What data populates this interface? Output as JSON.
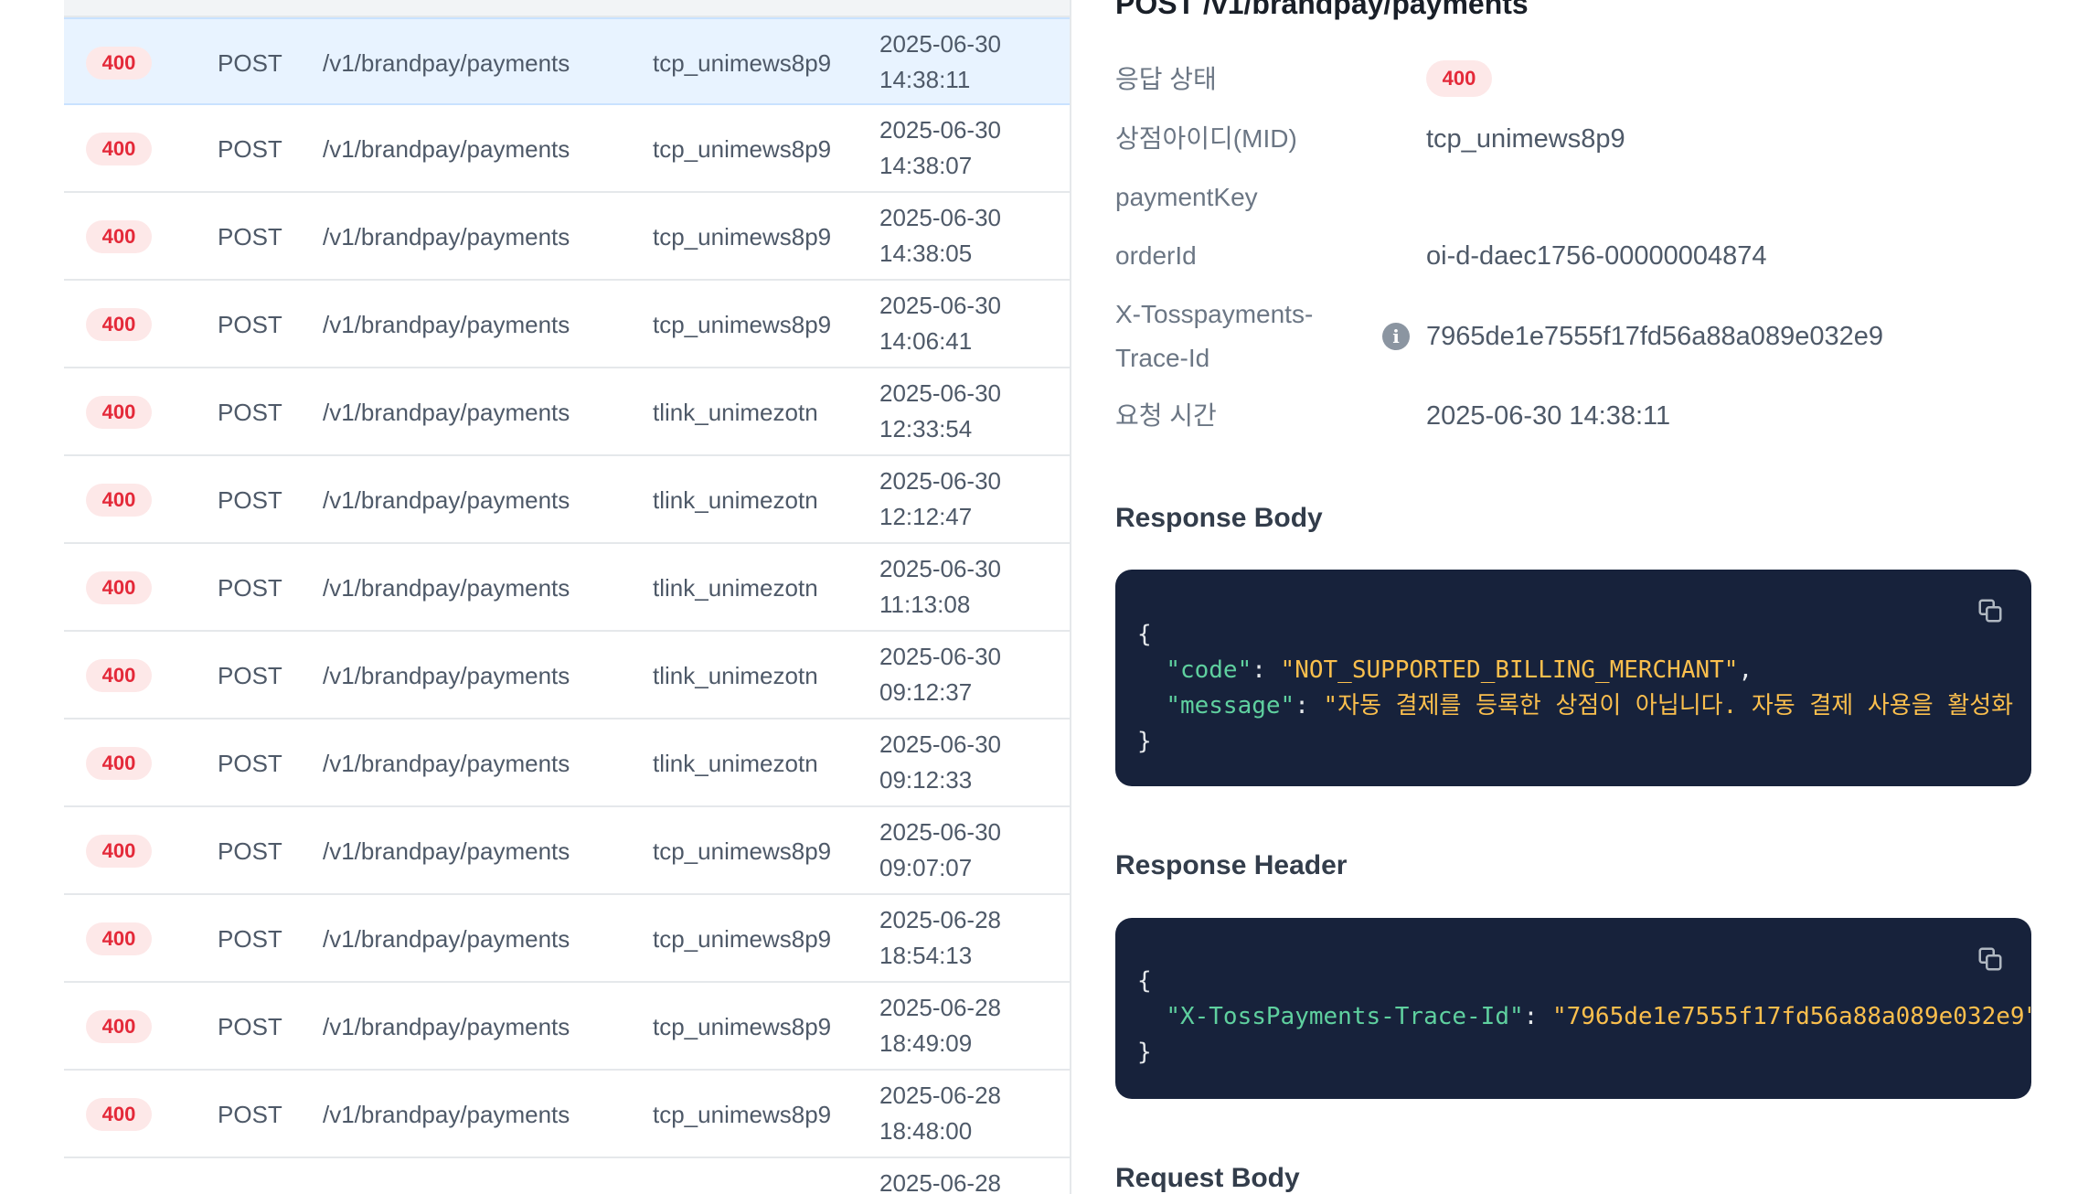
{
  "log_rows": [
    {
      "status": "400",
      "method": "POST",
      "path": "/v1/brandpay/payments",
      "mid": "tcp_unimews8p9",
      "date": "2025-06-30",
      "time": "14:38:11"
    },
    {
      "status": "400",
      "method": "POST",
      "path": "/v1/brandpay/payments",
      "mid": "tcp_unimews8p9",
      "date": "2025-06-30",
      "time": "14:38:07"
    },
    {
      "status": "400",
      "method": "POST",
      "path": "/v1/brandpay/payments",
      "mid": "tcp_unimews8p9",
      "date": "2025-06-30",
      "time": "14:38:05"
    },
    {
      "status": "400",
      "method": "POST",
      "path": "/v1/brandpay/payments",
      "mid": "tcp_unimews8p9",
      "date": "2025-06-30",
      "time": "14:06:41"
    },
    {
      "status": "400",
      "method": "POST",
      "path": "/v1/brandpay/payments",
      "mid": "tlink_unimezotn",
      "date": "2025-06-30",
      "time": "12:33:54"
    },
    {
      "status": "400",
      "method": "POST",
      "path": "/v1/brandpay/payments",
      "mid": "tlink_unimezotn",
      "date": "2025-06-30",
      "time": "12:12:47"
    },
    {
      "status": "400",
      "method": "POST",
      "path": "/v1/brandpay/payments",
      "mid": "tlink_unimezotn",
      "date": "2025-06-30",
      "time": "11:13:08"
    },
    {
      "status": "400",
      "method": "POST",
      "path": "/v1/brandpay/payments",
      "mid": "tlink_unimezotn",
      "date": "2025-06-30",
      "time": "09:12:37"
    },
    {
      "status": "400",
      "method": "POST",
      "path": "/v1/brandpay/payments",
      "mid": "tlink_unimezotn",
      "date": "2025-06-30",
      "time": "09:12:33"
    },
    {
      "status": "400",
      "method": "POST",
      "path": "/v1/brandpay/payments",
      "mid": "tcp_unimews8p9",
      "date": "2025-06-30",
      "time": "09:07:07"
    },
    {
      "status": "400",
      "method": "POST",
      "path": "/v1/brandpay/payments",
      "mid": "tcp_unimews8p9",
      "date": "2025-06-28",
      "time": "18:54:13"
    },
    {
      "status": "400",
      "method": "POST",
      "path": "/v1/brandpay/payments",
      "mid": "tcp_unimews8p9",
      "date": "2025-06-28",
      "time": "18:49:09"
    },
    {
      "status": "400",
      "method": "POST",
      "path": "/v1/brandpay/payments",
      "mid": "tcp_unimews8p9",
      "date": "2025-06-28",
      "time": "18:48:00"
    },
    {
      "status": "",
      "method": "",
      "path": "",
      "mid": "",
      "date": "2025-06-28",
      "time": ""
    }
  ],
  "detail": {
    "title": "POST /v1/brandpay/payments",
    "labels": {
      "status": "응답 상태",
      "mid": "상점아이디(MID)",
      "payment_key": "paymentKey",
      "order_id": "orderId",
      "trace_id_line1": "X-Tosspayments-",
      "trace_id_line2": "Trace-Id",
      "request_time": "요청 시간"
    },
    "values": {
      "status": "400",
      "mid": "tcp_unimews8p9",
      "payment_key": "",
      "order_id": "oi-d-daec1756-00000004874",
      "trace_id": "7965de1e7555f17fd56a88a089e032e9",
      "request_time": "2025-06-30 14:38:11"
    },
    "response_body_title": "Response Body",
    "response_body": {
      "open": "{",
      "code_key": "\"code\"",
      "code_value": "\"NOT_SUPPORTED_BILLING_MERCHANT\"",
      "message_key": "\"message\"",
      "message_value": "\"자동 결제를 등록한 상점이 아닙니다. 자동 결제 사용을 활성화",
      "close": "}"
    },
    "response_header_title": "Response Header",
    "response_header": {
      "open": "{",
      "trace_key": "\"X-TossPayments-Trace-Id\"",
      "trace_value": "\"7965de1e7555f17fd56a88a089e032e9\"",
      "close": "}"
    },
    "request_body_title": "Request Body"
  },
  "icons": {
    "info": "info-icon",
    "copy": "copy-icon"
  },
  "colors": {
    "error_badge_bg": "#fde8e8",
    "error_badge_text": "#e42939",
    "selected_row": "#e8f3ff",
    "code_bg": "#17223b",
    "code_key": "#5fd09f",
    "code_string": "#fbbf4d"
  }
}
